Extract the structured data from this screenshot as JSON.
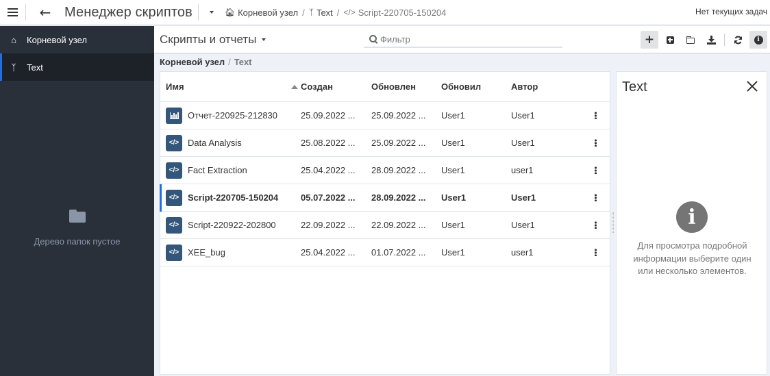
{
  "topbar": {
    "menu_icon": "hamburger-icon",
    "back_icon": "arrow-left-icon",
    "title": "Менеджер скриптов",
    "breadcrumb": [
      {
        "icon": "home-icon",
        "label": "Корневой узел"
      },
      {
        "icon": "branch-icon",
        "label": "Text"
      },
      {
        "icon": "code-icon",
        "label": "Script-220705-150204"
      }
    ],
    "tasks_label": "Нет текущих задач"
  },
  "sidebar": {
    "items": [
      {
        "icon": "home-icon",
        "label": "Корневой узел",
        "active": false
      },
      {
        "icon": "branch-icon",
        "label": "Text",
        "active": true
      }
    ],
    "empty_icon": "folder-icon",
    "empty_text": "Дерево папок пустое"
  },
  "main": {
    "section_title": "Скрипты и отчеты",
    "filter_placeholder": "Фильтр",
    "filter_value": "",
    "toolbar": [
      {
        "icon": "plus-icon",
        "label": "Создать"
      },
      {
        "icon": "plus-square-icon",
        "label": "Добавить"
      },
      {
        "icon": "folder-icon",
        "label": "Папка"
      },
      {
        "icon": "download-icon",
        "label": "Импорт"
      },
      {
        "icon": "refresh-icon",
        "label": "Обновить"
      },
      {
        "icon": "info-icon",
        "label": "Информация"
      }
    ],
    "path": {
      "root": "Корневой узел",
      "current": "Text"
    }
  },
  "table": {
    "columns": [
      "Имя",
      "Создан",
      "Обновлен",
      "Обновил",
      "Автор"
    ],
    "sort": {
      "column": "Имя",
      "direction": "asc"
    },
    "rows": [
      {
        "type": "report",
        "icon": "bar-chart-icon",
        "name": "Отчет-220925-212830",
        "created": "25.09.2022 ...",
        "updated": "25.09.2022 ...",
        "updated_by": "User1",
        "author": "User1",
        "selected": false
      },
      {
        "type": "script",
        "icon": "code-icon",
        "name": "Data Analysis",
        "created": "25.08.2022 ...",
        "updated": "25.09.2022 ...",
        "updated_by": "User1",
        "author": "User1",
        "selected": false
      },
      {
        "type": "script",
        "icon": "code-icon",
        "name": "Fact Extraction",
        "created": "25.04.2022 ...",
        "updated": "28.09.2022 ...",
        "updated_by": "User1",
        "author": "user1",
        "selected": false
      },
      {
        "type": "script",
        "icon": "code-icon",
        "name": "Script-220705-150204",
        "created": "05.07.2022 ...",
        "updated": "28.09.2022 ...",
        "updated_by": "User1",
        "author": "User1",
        "selected": true
      },
      {
        "type": "script",
        "icon": "code-icon",
        "name": "Script-220922-202800",
        "created": "22.09.2022 ...",
        "updated": "22.09.2022 ...",
        "updated_by": "User1",
        "author": "User1",
        "selected": false
      },
      {
        "type": "script",
        "icon": "code-icon",
        "name": "XEE_bug",
        "created": "25.04.2022 ...",
        "updated": "01.07.2022 ...",
        "updated_by": "User1",
        "author": "user1",
        "selected": false
      }
    ]
  },
  "details": {
    "title": "Text",
    "info_text": "Для просмотра подробной информации выберите один или несколько элементов."
  },
  "colors": {
    "sidebar_bg": "#2a303a",
    "sidebar_active_bg": "#1d2128",
    "accent": "#1f6fe0",
    "row_icon_bg": "#34567a",
    "page_bg": "#eef2f8"
  }
}
